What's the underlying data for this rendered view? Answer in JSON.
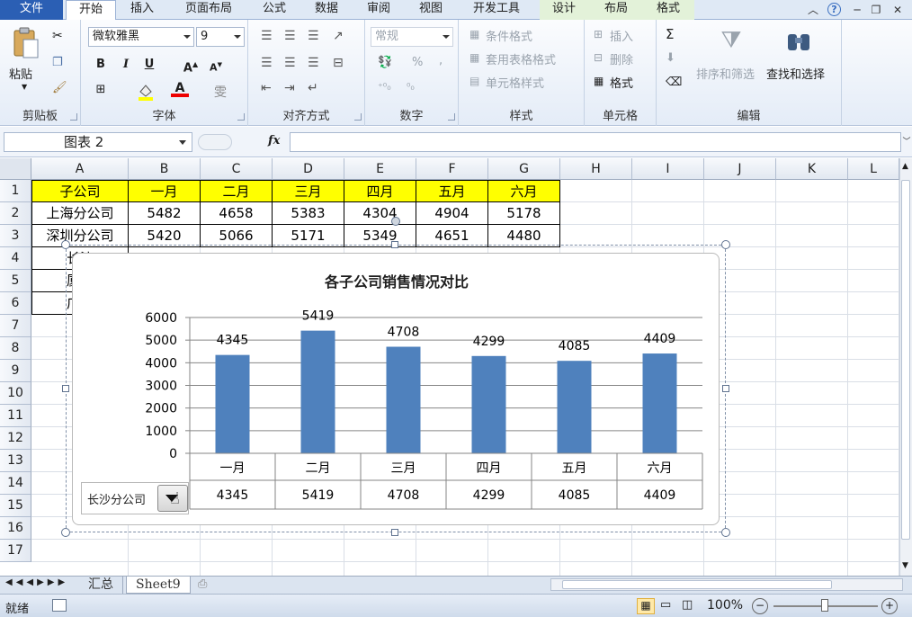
{
  "tabs": {
    "file": "文件",
    "items": [
      {
        "label": "开始"
      },
      {
        "label": "插入"
      },
      {
        "label": "页面布局"
      },
      {
        "label": "公式"
      },
      {
        "label": "数据"
      },
      {
        "label": "审阅"
      },
      {
        "label": "视图"
      },
      {
        "label": "开发工具"
      },
      {
        "label": "设计"
      },
      {
        "label": "布局"
      },
      {
        "label": "格式"
      }
    ]
  },
  "ribbon": {
    "clipboard": {
      "paste": "粘贴",
      "label": "剪贴板"
    },
    "font": {
      "name": "微软雅黑",
      "size": "9",
      "label": "字体",
      "bold": "B",
      "italic": "I",
      "underline": "U"
    },
    "alignment": {
      "label": "对齐方式"
    },
    "number": {
      "format": "常规",
      "label": "数字",
      "percent": "%",
      "comma": ","
    },
    "styles": {
      "conditional": "条件格式",
      "table": "套用表格格式",
      "cell": "单元格样式",
      "label": "样式"
    },
    "cells": {
      "insert": "插入",
      "delete": "删除",
      "format": "格式",
      "label": "单元格"
    },
    "editing": {
      "sum": "Σ",
      "sort": "排序和筛选",
      "find": "查找和选择",
      "label": "编辑"
    }
  },
  "formula_bar": {
    "name_box": "图表 2",
    "fx": "fx",
    "formula": ""
  },
  "sheet": {
    "columns": [
      "A",
      "B",
      "C",
      "D",
      "E",
      "F",
      "G",
      "H",
      "I",
      "J",
      "K",
      "L"
    ],
    "rows": [
      "1",
      "2",
      "3",
      "4",
      "5",
      "6",
      "7",
      "8",
      "9",
      "10",
      "11",
      "12",
      "13",
      "14",
      "15",
      "16",
      "17"
    ],
    "table": {
      "header": [
        "子公司",
        "一月",
        "二月",
        "三月",
        "四月",
        "五月",
        "六月"
      ],
      "rows": [
        [
          "上海分公司",
          "5482",
          "4658",
          "5383",
          "4304",
          "4904",
          "5178"
        ],
        [
          "深圳分公司",
          "5420",
          "5066",
          "5171",
          "5349",
          "4651",
          "4480"
        ],
        [
          "长沙",
          "",
          "",
          "",
          "",
          "",
          ""
        ],
        [
          "厦门",
          "",
          "",
          "",
          "",
          "",
          ""
        ],
        [
          "广州",
          "",
          "",
          "",
          "",
          "",
          ""
        ]
      ]
    }
  },
  "chart_data": {
    "type": "bar",
    "title": "各子公司销售情况对比",
    "categories": [
      "一月",
      "二月",
      "三月",
      "四月",
      "五月",
      "六月"
    ],
    "values": [
      4345,
      5419,
      4708,
      4299,
      4085,
      4409
    ],
    "ylim": [
      0,
      6000
    ],
    "yticks": [
      "6000",
      "5000",
      "4000",
      "3000",
      "2000",
      "1000",
      "0"
    ],
    "grid": true,
    "bar_color": "#4f81bd",
    "data_table": true,
    "selector": {
      "selected": "长沙分公司"
    }
  },
  "sheet_tabs": [
    {
      "label": "汇总"
    },
    {
      "label": "Sheet9"
    }
  ],
  "status": {
    "ready": "就绪",
    "zoom": "100%"
  }
}
